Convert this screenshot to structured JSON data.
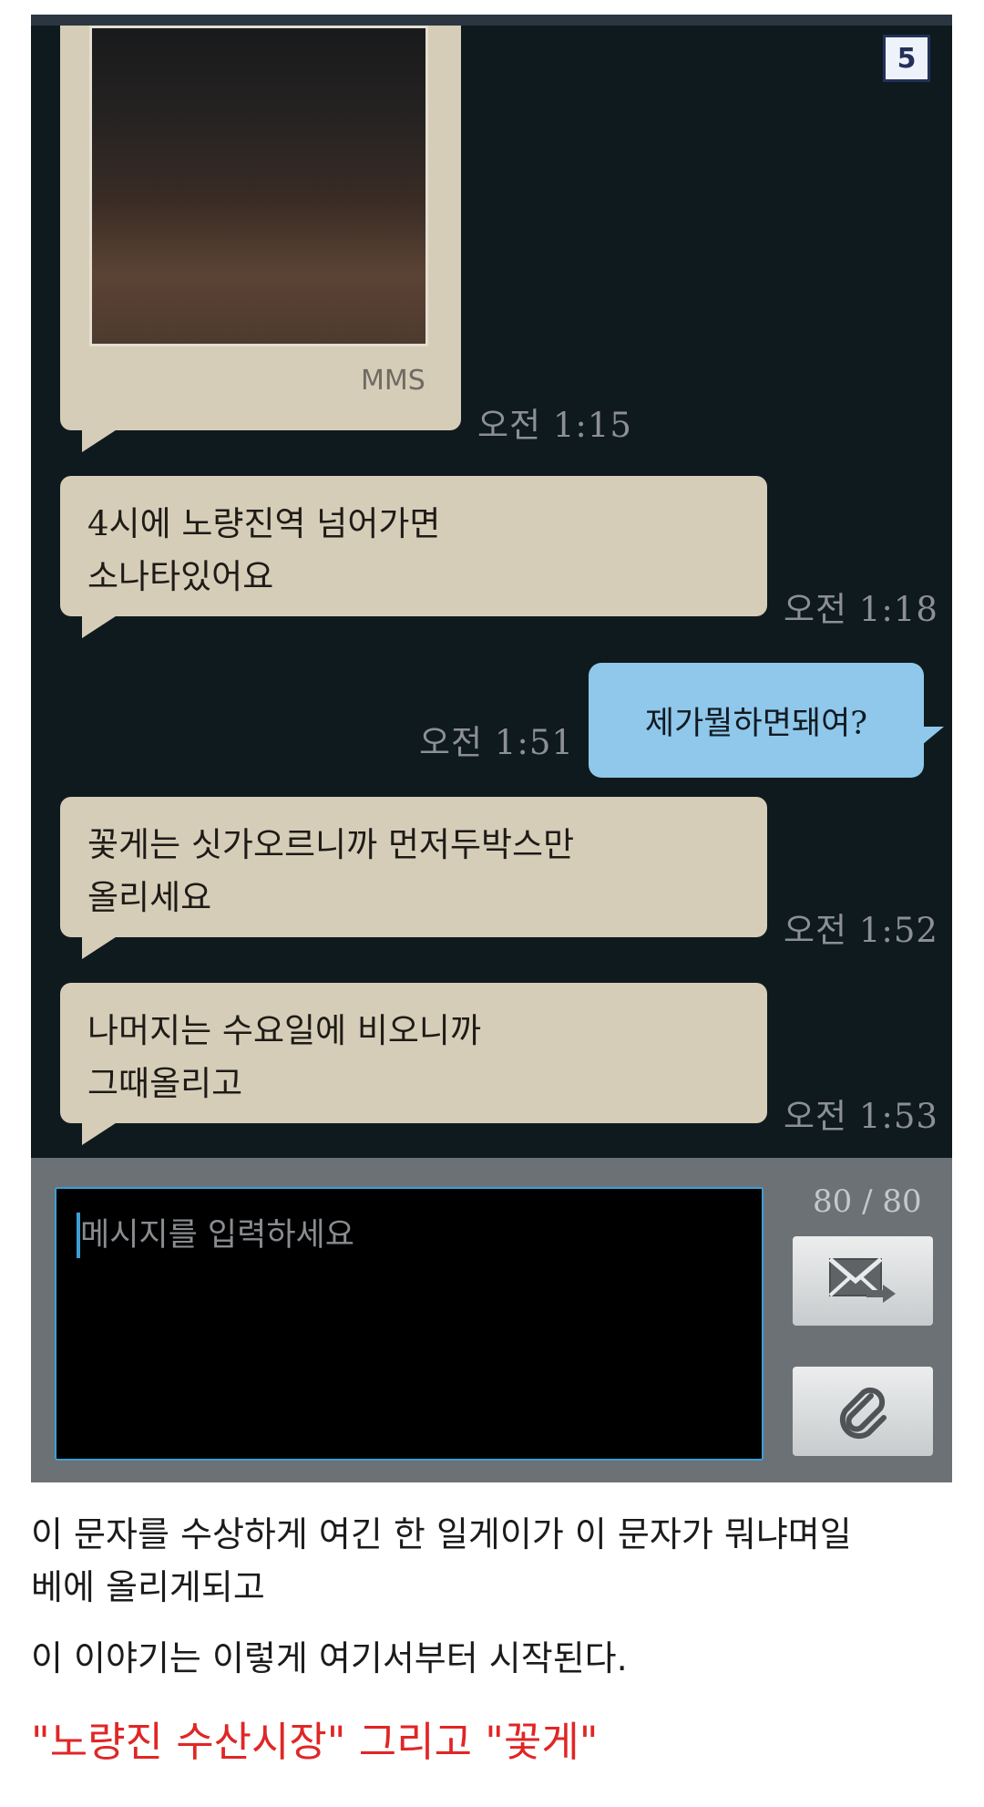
{
  "page_badge": "5",
  "conversation": {
    "mms_label": "MMS",
    "messages": [
      {
        "direction": "incoming",
        "type": "mms",
        "text": "",
        "time": "오전 1:15"
      },
      {
        "direction": "incoming",
        "type": "text",
        "text": "4시에 노량진역 넘어가면\n소나타있어요",
        "time": "오전 1:18"
      },
      {
        "direction": "outgoing",
        "type": "text",
        "text": "제가뭘하면돼여?",
        "time": "오전 1:51"
      },
      {
        "direction": "incoming",
        "type": "text",
        "text": "꽃게는 싯가오르니까 먼저두박스만\n올리세요",
        "time": "오전 1:52"
      },
      {
        "direction": "incoming",
        "type": "text",
        "text": "나머지는 수요일에 비오니까\n그때올리고",
        "time": "오전 1:53"
      }
    ]
  },
  "composer": {
    "placeholder": "메시지를 입력하세요",
    "char_counter": "80 / 80",
    "send_icon": "envelope-send-icon",
    "attach_icon": "paperclip-icon"
  },
  "caption": {
    "line1": "이 문자를 수상하게 여긴 한 일게이가 이 문자가 뭐냐며일",
    "line2": "베에 올리게되고",
    "line3": "이 이야기는 이렇게 여기서부터 시작된다.",
    "headline": "\"노량진 수산시장\" 그리고 \"꽃게\""
  },
  "colors": {
    "chat_background": "#0f1a1e",
    "incoming_bubble": "#d6cdb8",
    "outgoing_bubble": "#8fc8ea",
    "headline_red": "#e02626",
    "input_border": "#3d9fd6"
  }
}
